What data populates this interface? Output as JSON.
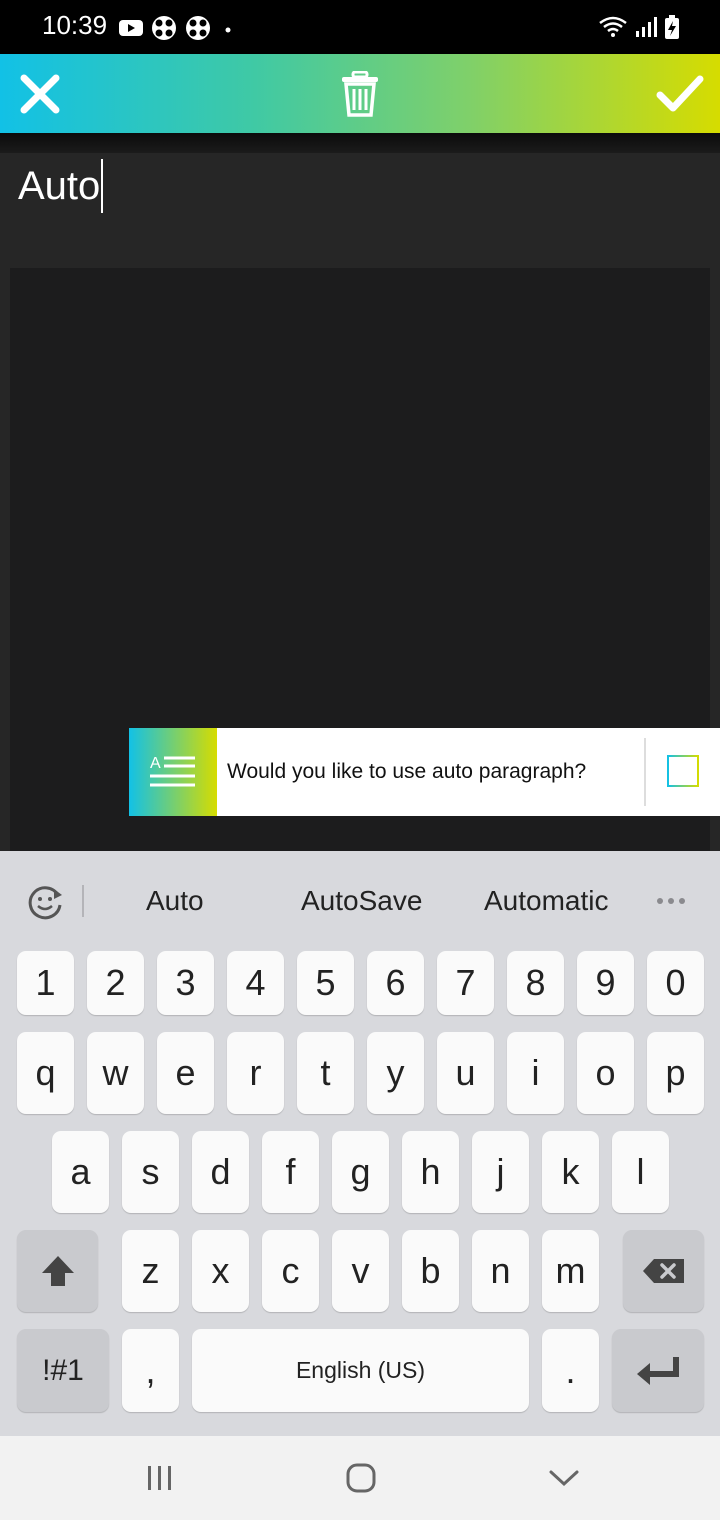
{
  "status_bar": {
    "time": "10:39",
    "icons_left": [
      "youtube-icon",
      "app-icon",
      "app-icon",
      "dot-icon"
    ],
    "icons_right": [
      "wifi-icon",
      "signal-icon",
      "battery-icon"
    ]
  },
  "toolbar": {
    "colors": [
      "#12c1e6",
      "#d6dc00"
    ],
    "icons": [
      "close-icon",
      "trash-icon",
      "check-icon"
    ]
  },
  "note": {
    "title_value": "Auto",
    "body_value": ""
  },
  "prompt": {
    "text": "Would you like to use auto paragraph?",
    "icon": "paragraph-icon",
    "checked": false
  },
  "keyboard": {
    "suggestions": [
      "Auto",
      "AutoSave",
      "Automatic"
    ],
    "more_icon": "more-icon",
    "refresh_icon": "emoji-refresh-icon",
    "row_numbers": [
      "1",
      "2",
      "3",
      "4",
      "5",
      "6",
      "7",
      "8",
      "9",
      "0"
    ],
    "row_1": [
      "q",
      "w",
      "e",
      "r",
      "t",
      "y",
      "u",
      "i",
      "o",
      "p"
    ],
    "row_2": [
      "a",
      "s",
      "d",
      "f",
      "g",
      "h",
      "j",
      "k",
      "l"
    ],
    "row_3": [
      "z",
      "x",
      "c",
      "v",
      "b",
      "n",
      "m"
    ],
    "symbols_label": "!#1",
    "comma_label": ",",
    "space_label": "English (US)",
    "period_label": "."
  },
  "navbar": {
    "icons": [
      "recent-apps-icon",
      "home-icon",
      "back-icon"
    ]
  }
}
